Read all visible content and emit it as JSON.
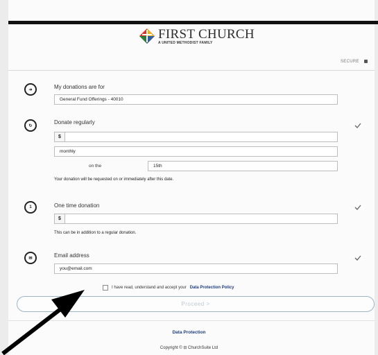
{
  "header": {
    "logo_title": "FIRST CHURCH",
    "logo_subtitle": "A UNITED METHODIST FAMILY",
    "secure_label": "SECURE"
  },
  "form": {
    "donations_for": {
      "label": "My donations are for",
      "value": "General Fund Offerings - 40010",
      "icon": "arrow-right-icon"
    },
    "regular": {
      "label": "Donate regularly",
      "currency_symbol": "$",
      "amount_value": "",
      "frequency_value": "monthly",
      "on_the_label": "on the",
      "day_value": "15th",
      "note": "Your donation will be requested on or immediately after this date.",
      "icon": "recurring-icon"
    },
    "one_time": {
      "label": "One time donation",
      "currency_symbol": "$",
      "amount_value": "",
      "note": "This can be in addition to a regular donation.",
      "icon": "one-time-icon"
    },
    "email": {
      "label": "Email address",
      "value": "you@email.com",
      "icon": "email-icon"
    },
    "consent": {
      "text": "I have read, understand and accept your",
      "link": "Data Protection Policy",
      "checked": false
    },
    "proceed_label": "Proceed >"
  },
  "footer": {
    "link": "Data Protection",
    "copyright": "Copyright © ⊟ ChurchSuite Ltd"
  },
  "colors": {
    "accent_link": "#1e3d7c",
    "proceed_border": "#9ab5c7",
    "top_bar": "#111111"
  }
}
